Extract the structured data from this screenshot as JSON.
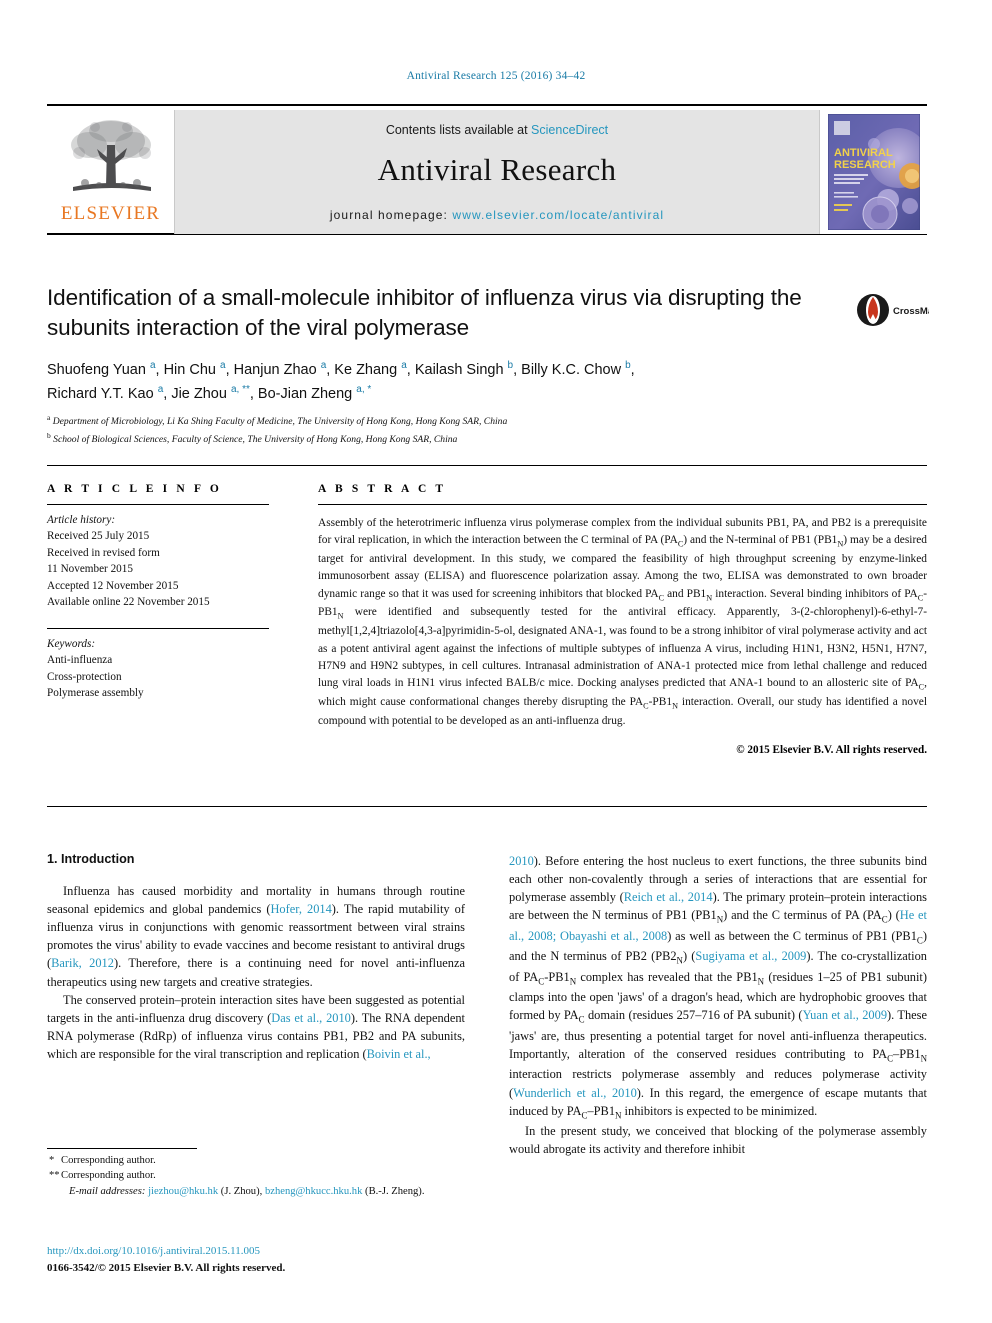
{
  "running_head": "Antiviral Research 125 (2016) 34–42",
  "masthead": {
    "contents_prefix": "Contents lists available at ",
    "sciencedirect": "ScienceDirect",
    "journal_title": "Antiviral Research",
    "homepage_label": "journal homepage: ",
    "homepage_url": "www.elsevier.com/locate/antiviral",
    "publisher": "ELSEVIER",
    "cover_title_line1": "ANTIVIRAL",
    "cover_title_line2": "RESEARCH"
  },
  "article": {
    "title": "Identification of a small-molecule inhibitor of influenza virus via disrupting the subunits interaction of the viral polymerase",
    "crossmark_label": "CrossMark",
    "authors_line1_html": "Shuofeng Yuan <sup>a</sup>, Hin Chu <sup>a</sup>, Hanjun Zhao <sup>a</sup>, Ke Zhang <sup>a</sup>, Kailash Singh <sup>b</sup>, Billy K.C. Chow <sup>b</sup>,",
    "authors_line2_html": "Richard Y.T. Kao <sup>a</sup>, Jie Zhou <sup>a, **</sup>, Bo-Jian Zheng <sup>a, *</sup>",
    "affiliation_a_html": "<sup>a</sup> Department of Microbiology, Li Ka Shing Faculty of Medicine, The University of Hong Kong, Hong Kong SAR, China",
    "affiliation_b_html": "<sup>b</sup> School of Biological Sciences, Faculty of Science, The University of Hong Kong, Hong Kong SAR, China"
  },
  "article_info": {
    "heading": "A R T I C L E   I N F O",
    "history_label": "Article history:",
    "history_lines": [
      "Received 25 July 2015",
      "Received in revised form",
      "11 November 2015",
      "Accepted 12 November 2015",
      "Available online 22 November 2015"
    ],
    "keywords_label": "Keywords:",
    "keywords": [
      "Anti-influenza",
      "Cross-protection",
      "Polymerase assembly"
    ]
  },
  "abstract": {
    "heading": "A B S T R A C T",
    "body_html": "Assembly of the heterotrimeric influenza virus polymerase complex from the individual subunits PB1, PA, and PB2 is a prerequisite for viral replication, in which the interaction between the C terminal of PA (PA<sub>C</sub>) and the N-terminal of PB1 (PB1<sub>N</sub>) may be a desired target for antiviral development. In this study, we compared the feasibility of high throughput screening by enzyme-linked immunosorbent assay (ELISA) and fluorescence polarization assay. Among the two, ELISA was demonstrated to own broader dynamic range so that it was used for screening inhibitors that blocked PA<sub>C</sub> and PB1<sub>N</sub> interaction. Several binding inhibitors of PA<sub>C</sub>-PB1<sub>N</sub> were identified and subsequently tested for the antiviral efficacy. Apparently, 3-(2-chlorophenyl)-6-ethyl-7-methyl[1,2,4]triazolo[4,3-a]pyrimidin-5-ol, designated ANA-1, was found to be a strong inhibitor of viral polymerase activity and act as a potent antiviral agent against the infections of multiple subtypes of influenza A virus, including H1N1, H3N2, H5N1, H7N7, H7N9 and H9N2 subtypes, in cell cultures. Intranasal administration of ANA-1 protected mice from lethal challenge and reduced lung viral loads in H1N1 virus infected BALB/c mice. Docking analyses predicted that ANA-1 bound to an allosteric site of PA<sub>C</sub>, which might cause conformational changes thereby disrupting the PA<sub>C</sub>-PB1<sub>N</sub> interaction. Overall, our study has identified a novel compound with potential to be developed as an anti-influenza drug.",
    "copyright": "© 2015 Elsevier B.V. All rights reserved."
  },
  "introduction": {
    "heading": "1. Introduction",
    "left_paragraphs_html": [
      "Influenza has caused morbidity and mortality in humans through routine seasonal epidemics and global pandemics (<span class=\"cite\">Hofer, 2014</span>). The rapid mutability of influenza virus in conjunctions with genomic reassortment between viral strains promotes the virus' ability to evade vaccines and become resistant to antiviral drugs (<span class=\"cite\">Barik, 2012</span>). Therefore, there is a continuing need for novel anti-influenza therapeutics using new targets and creative strategies.",
      "The conserved protein–protein interaction sites have been suggested as potential targets in the anti-influenza drug discovery (<span class=\"cite\">Das et al., 2010</span>). The RNA dependent RNA polymerase (RdRp) of influenza virus contains PB1, PB2 and PA subunits, which are responsible for the viral transcription and replication (<span class=\"cite\">Boivin et al.,</span>"
    ],
    "right_paragraphs_html": [
      "<span class=\"cite\">2010</span>). Before entering the host nucleus to exert functions, the three subunits bind each other non-covalently through a series of interactions that are essential for polymerase assembly (<span class=\"cite\">Reich et al., 2014</span>). The primary protein–protein interactions are between the N terminus of PB1 (PB1<sub>N</sub>) and the C terminus of PA (PA<sub>C</sub>) (<span class=\"cite\">He et al., 2008; Obayashi et al., 2008</span>) as well as between the C terminus of PB1 (PB1<sub>C</sub>) and the N terminus of PB2 (PB2<sub>N</sub>) (<span class=\"cite\">Sugiyama et al., 2009</span>). The co-crystallization of PA<sub>C</sub>-PB1<sub>N</sub> complex has revealed that the PB1<sub>N</sub> (residues 1–25 of PB1 subunit) clamps into the open 'jaws' of a dragon's head, which are hydrophobic grooves that formed by PA<sub>C</sub> domain (residues 257–716 of PA subunit) (<span class=\"cite\">Yuan et al., 2009</span>). These 'jaws' are, thus presenting a potential target for novel anti-influenza therapeutics. Importantly, alteration of the conserved residues contributing to PA<sub>C</sub>–PB1<sub>N</sub> interaction restricts polymerase assembly and reduces polymerase activity (<span class=\"cite\">Wunderlich et al., 2010</span>). In this regard, the emergence of escape mutants that induced by PA<sub>C</sub>–PB1<sub>N</sub> inhibitors is expected to be minimized.",
      "In the present study, we conceived that blocking of the polymerase assembly would abrogate its activity and therefore inhibit"
    ]
  },
  "footnotes": {
    "corresponding_1": "Corresponding author.",
    "corresponding_2": "Corresponding author.",
    "email_label": "E-mail addresses:",
    "email_1": "jiezhou@hku.hk",
    "email_1_owner": "(J. Zhou),",
    "email_2": "bzheng@hkucc.hku.hk",
    "email_2_owner": "(B.-J. Zheng).",
    "doi": "http://dx.doi.org/10.1016/j.antiviral.2015.11.005",
    "issn_line": "0166-3542/© 2015 Elsevier B.V. All rights reserved."
  },
  "colors": {
    "link": "#2596be",
    "running_head": "#1a7ba6",
    "elsevier_orange": "#E87722",
    "masthead_bg": "#e4e4e4"
  }
}
